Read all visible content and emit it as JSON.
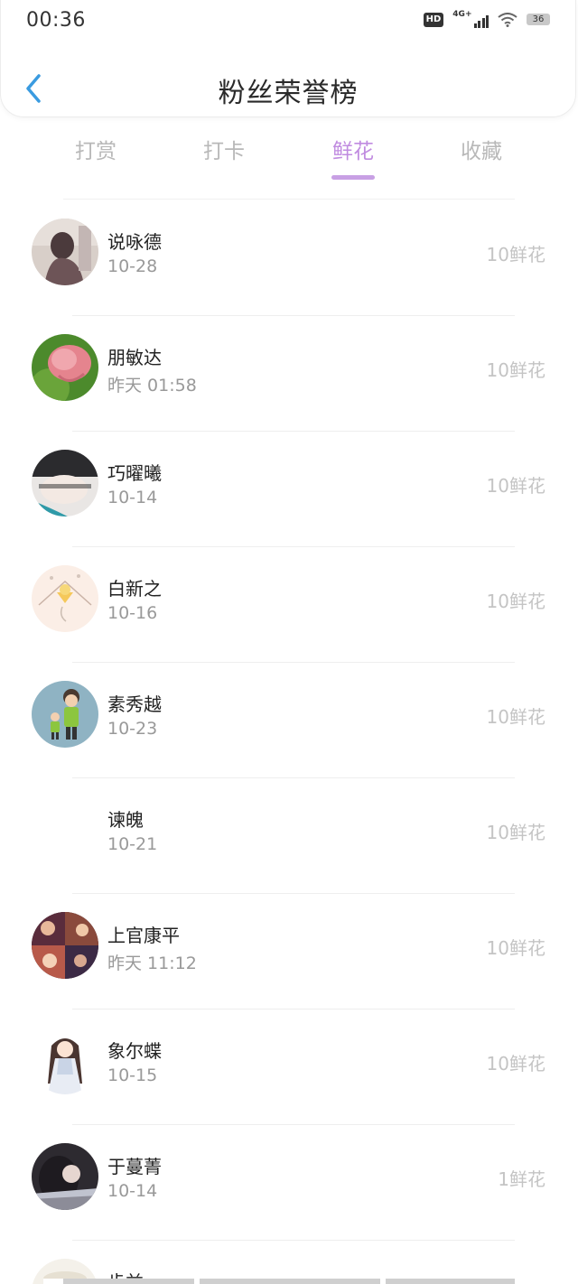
{
  "status": {
    "time": "00:36",
    "hd": "HD",
    "network": "4G+",
    "battery": "36"
  },
  "header": {
    "title": "粉丝荣誉榜"
  },
  "tabs": [
    {
      "label": "打赏",
      "active": false
    },
    {
      "label": "打卡",
      "active": false
    },
    {
      "label": "鲜花",
      "active": true
    },
    {
      "label": "收藏",
      "active": false
    }
  ],
  "fans": [
    {
      "name": "说咏德",
      "date": "10-28",
      "score": "10鲜花",
      "avatar": "avatar-photo-figure"
    },
    {
      "name": "朋敏达",
      "date": "昨天 01:58",
      "score": "10鲜花",
      "avatar": "avatar-photo-flower"
    },
    {
      "name": "巧曜曦",
      "date": "10-14",
      "score": "10鲜花",
      "avatar": "avatar-photo-hand"
    },
    {
      "name": "白新之",
      "date": "10-16",
      "score": "10鲜花",
      "avatar": "avatar-drawing"
    },
    {
      "name": "素秀越",
      "date": "10-23",
      "score": "10鲜花",
      "avatar": "avatar-cartoon"
    },
    {
      "name": "谏魄",
      "date": "10-21",
      "score": "10鲜花",
      "avatar": "avatar-empty"
    },
    {
      "name": "上官康平",
      "date": "昨天 11:12",
      "score": "10鲜花",
      "avatar": "avatar-photo-collage"
    },
    {
      "name": "象尔蝶",
      "date": "10-15",
      "score": "10鲜花",
      "avatar": "avatar-anime-girl"
    },
    {
      "name": "于蔓菁",
      "date": "10-14",
      "score": "1鲜花",
      "avatar": "avatar-photo-dark"
    },
    {
      "name": "步益",
      "date": "",
      "score": "",
      "avatar": "avatar-cup"
    }
  ],
  "colors": {
    "accent": "#c08be0",
    "indicator": "#c8a0e4",
    "back": "#3a9be0"
  }
}
